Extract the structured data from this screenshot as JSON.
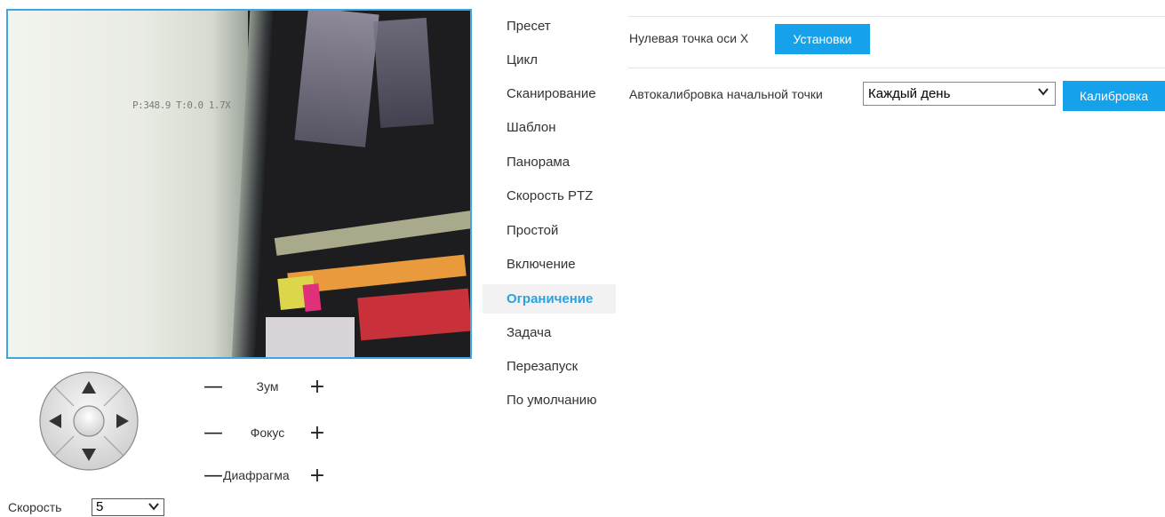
{
  "video": {
    "osd_text": "P:348.9 T:0.0 1.7X"
  },
  "joystick": {
    "up": "up-arrow",
    "down": "down-arrow",
    "left": "left-arrow",
    "right": "right-arrow",
    "center": "center-button"
  },
  "controls": {
    "minus_symbol": "—",
    "plus_symbol": "+",
    "zoom_label": "Зум",
    "focus_label": "Фокус",
    "iris_label": "Диафрагма"
  },
  "speed": {
    "label": "Скорость",
    "value": "5"
  },
  "menu": {
    "items": [
      "Пресет",
      "Цикл",
      "Сканирование",
      "Шаблон",
      "Панорама",
      "Скорость PTZ",
      "Простой",
      "Включение",
      "Ограничение",
      "Задача",
      "Перезапуск",
      "По умолчанию"
    ],
    "active": "Ограничение"
  },
  "settings": {
    "zero_point_label": "Нулевая точка оси X",
    "set_button": "Установки",
    "auto_calibration_label": "Автокалибровка начальной точки",
    "auto_calibration_value": "Каждый день",
    "calibrate_button": "Калибровка"
  },
  "colors": {
    "accent": "#16a2ea",
    "active_menu": "#2aa2e0",
    "video_border": "#3ea6e3"
  }
}
